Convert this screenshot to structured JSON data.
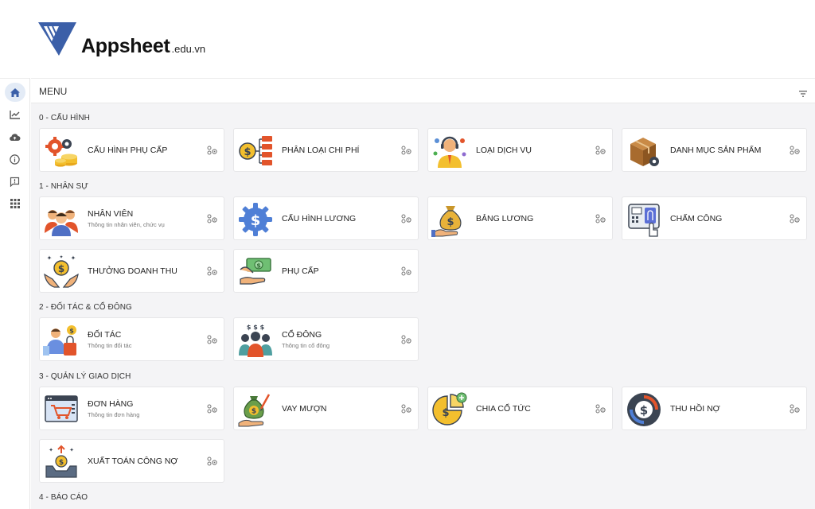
{
  "brand": {
    "name": "Appsheet",
    "suffix": ".edu.vn"
  },
  "header": {
    "title": "MENU"
  },
  "sidebar": {
    "icons": [
      "home-icon",
      "trend-chart-icon",
      "cloud-upload-icon",
      "info-icon",
      "feedback-icon",
      "apps-grid-icon"
    ]
  },
  "colors": {
    "accent": "#3b5fa8",
    "background": "#f4f4f6"
  },
  "sections": [
    {
      "title": "0 - CẤU HÌNH",
      "items": [
        {
          "label": "CẤU HÌNH PHỤ CẤP",
          "sub": "",
          "icon": "gears-coins-icon"
        },
        {
          "label": "PHÂN LOẠI CHI PHÍ",
          "sub": "",
          "icon": "cost-tree-icon"
        },
        {
          "label": "LOẠI DỊCH VỤ",
          "sub": "",
          "icon": "support-agent-icon"
        },
        {
          "label": "DANH MỤC SẢN PHẨM",
          "sub": "",
          "icon": "product-box-icon"
        }
      ]
    },
    {
      "title": "1 - NHÂN SỰ",
      "items": [
        {
          "label": "NHÂN VIÊN",
          "sub": "Thông tin nhân viên, chức vụ",
          "icon": "employees-icon"
        },
        {
          "label": "CẤU HÌNH LƯƠNG",
          "sub": "",
          "icon": "salary-gear-icon"
        },
        {
          "label": "BẢNG LƯƠNG",
          "sub": "",
          "icon": "money-bag-hand-icon"
        },
        {
          "label": "CHẤM CÔNG",
          "sub": "",
          "icon": "fingerprint-scanner-icon"
        },
        {
          "label": "THƯỞNG DOANH THU",
          "sub": "",
          "icon": "bonus-coin-hands-icon"
        },
        {
          "label": "PHỤ CẤP",
          "sub": "",
          "icon": "cash-hand-icon"
        }
      ]
    },
    {
      "title": "2 - ĐỐI TÁC & CỔ ĐÔNG",
      "items": [
        {
          "label": "ĐỐI TÁC",
          "sub": "Thông tin đối tác",
          "icon": "partner-shopping-icon"
        },
        {
          "label": "CỔ ĐÔNG",
          "sub": "Thông tin cổ đông",
          "icon": "shareholders-icon"
        }
      ]
    },
    {
      "title": "3 - QUẢN LÝ GIAO DỊCH",
      "items": [
        {
          "label": "ĐƠN HÀNG",
          "sub": "Thông tin đơn hàng",
          "icon": "online-order-icon"
        },
        {
          "label": "VAY MƯỢN",
          "sub": "",
          "icon": "loan-bag-icon"
        },
        {
          "label": "CHIA CỔ TỨC",
          "sub": "",
          "icon": "dividend-pie-icon"
        },
        {
          "label": "THU HỒI NỢ",
          "sub": "",
          "icon": "debt-recovery-icon"
        },
        {
          "label": "XUẤT TOÁN CÔNG NỢ",
          "sub": "",
          "icon": "export-debt-icon"
        }
      ]
    },
    {
      "title": "4 - BÁO CÁO",
      "items": []
    }
  ]
}
